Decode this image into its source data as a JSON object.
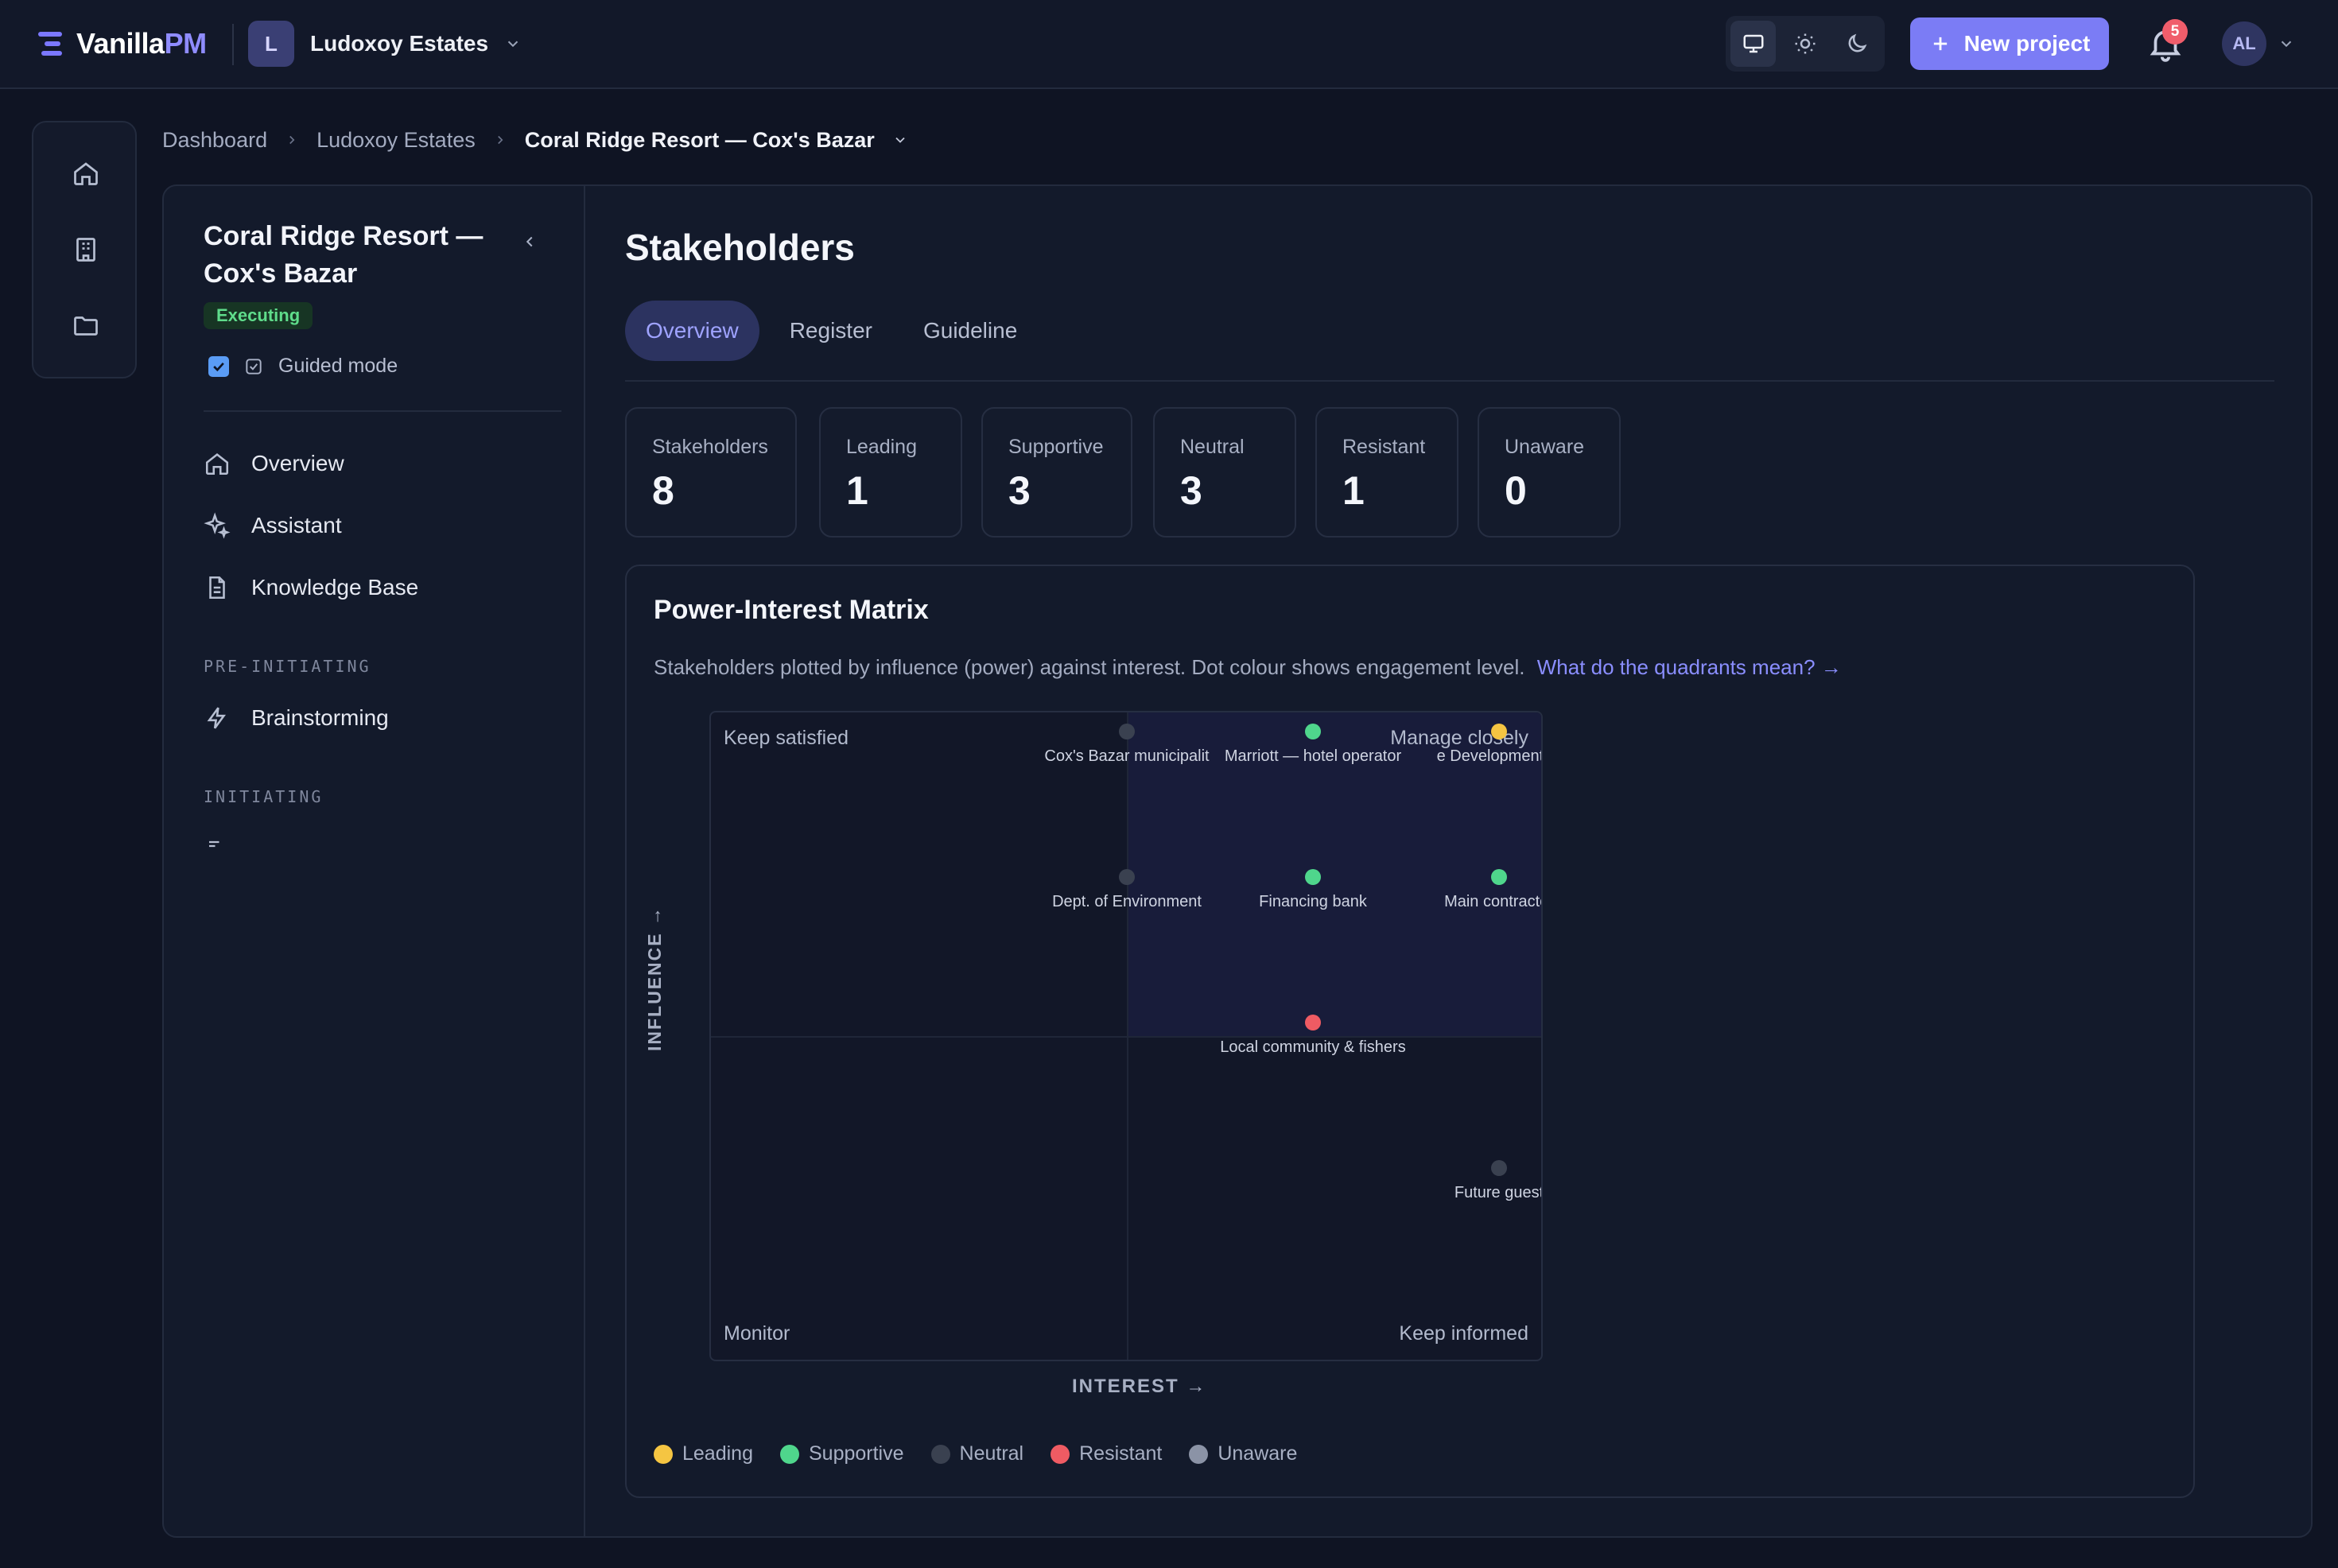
{
  "app": {
    "logo_text_main": "Vanilla",
    "logo_text_accent": "PM"
  },
  "workspace": {
    "initial": "L",
    "name": "Ludoxoy Estates"
  },
  "topbar": {
    "new_project_label": "New project",
    "notifications_count": "5",
    "user_initials": "AL"
  },
  "breadcrumb": {
    "items": [
      "Dashboard",
      "Ludoxoy Estates"
    ],
    "current": "Coral Ridge Resort — Cox's Bazar"
  },
  "project": {
    "title_line1": "Coral Ridge Resort —",
    "title_line2": "Cox's Bazar",
    "status": "Executing",
    "guided_mode_label": "Guided mode"
  },
  "sidebar": {
    "items": [
      {
        "label": "Overview",
        "icon": "home-icon"
      },
      {
        "label": "Assistant",
        "icon": "sparkles-icon"
      },
      {
        "label": "Knowledge Base",
        "icon": "document-icon"
      }
    ],
    "section_preinitiating": "PRE-INITIATING",
    "preinitiating_items": [
      {
        "label": "Brainstorming",
        "icon": "lightning-icon"
      }
    ],
    "section_initiating": "INITIATING"
  },
  "page": {
    "title": "Stakeholders"
  },
  "tabs": [
    {
      "label": "Overview",
      "active": true
    },
    {
      "label": "Register",
      "active": false
    },
    {
      "label": "Guideline",
      "active": false
    }
  ],
  "stats": [
    {
      "label": "Stakeholders",
      "value": "8"
    },
    {
      "label": "Leading",
      "value": "1"
    },
    {
      "label": "Supportive",
      "value": "3"
    },
    {
      "label": "Neutral",
      "value": "3"
    },
    {
      "label": "Resistant",
      "value": "1"
    },
    {
      "label": "Unaware",
      "value": "0"
    }
  ],
  "matrix": {
    "title": "Power-Interest Matrix",
    "description": "Stakeholders plotted by influence (power) against interest. Dot colour shows engagement level.",
    "link": "What do the quadrants mean? →",
    "quadrants": {
      "top_left": "Keep satisfied",
      "top_right": "Manage closely",
      "bottom_left": "Monitor",
      "bottom_right": "Keep informed"
    },
    "y_axis": "INFLUENCE →",
    "x_axis": "INTEREST →"
  },
  "legend": [
    {
      "label": "Leading",
      "color": "#f5c542"
    },
    {
      "label": "Supportive",
      "color": "#4fd68c"
    },
    {
      "label": "Neutral",
      "color": "#3a4150"
    },
    {
      "label": "Resistant",
      "color": "#ef5b63"
    },
    {
      "label": "Unaware",
      "color": "#8b93a6"
    }
  ],
  "colors": {
    "accent": "#7b7cf5",
    "leading": "#f5c542",
    "supportive": "#4fd68c",
    "neutral": "#3a4150",
    "resistant": "#ef5b63",
    "unaware": "#8b93a6"
  },
  "chart_data": {
    "type": "scatter",
    "title": "Power-Interest Matrix",
    "xlabel": "INTEREST →",
    "ylabel": "INFLUENCE →",
    "points": [
      {
        "name": "Cox's Bazar municipality",
        "interest": 3,
        "influence": 5,
        "engagement": "neutral",
        "shown_label": "Cox's Bazar municipalit"
      },
      {
        "name": "Marriott — hotel operator",
        "interest": 4,
        "influence": 5,
        "engagement": "supportive",
        "shown_label": "Marriott — hotel operator"
      },
      {
        "name": "Ludoxoy Developments",
        "interest": 5,
        "influence": 5,
        "engagement": "leading",
        "shown_label": "e Developments ("
      },
      {
        "name": "Dept. of Environment",
        "interest": 3,
        "influence": 4,
        "engagement": "neutral",
        "shown_label": "Dept. of Environment"
      },
      {
        "name": "Financing bank",
        "interest": 4,
        "influence": 4,
        "engagement": "supportive",
        "shown_label": "Financing bank"
      },
      {
        "name": "Main contractor",
        "interest": 5,
        "influence": 4,
        "engagement": "supportive",
        "shown_label": "Main contractor"
      },
      {
        "name": "Local community & fishers",
        "interest": 4,
        "influence": 3,
        "engagement": "resistant",
        "shown_label": "Local community & fishers"
      },
      {
        "name": "Future guests",
        "interest": 5,
        "influence": 2,
        "engagement": "neutral",
        "shown_label": "Future guest"
      }
    ]
  }
}
